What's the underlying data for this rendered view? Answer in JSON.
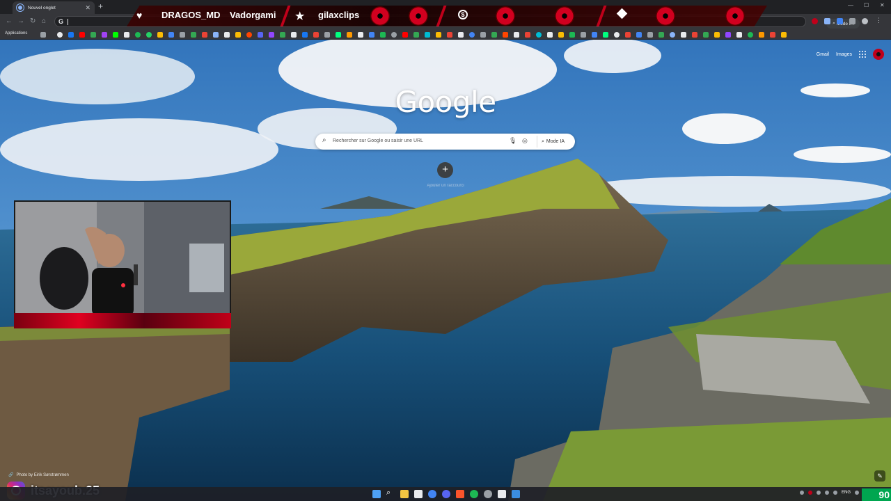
{
  "tab": {
    "title": "Nouvel onglet"
  },
  "toolbar": {
    "omnibox_prefix": "G",
    "mode_ia": "Mode IA"
  },
  "bookmarks": {
    "apps_label": "Applications"
  },
  "overlay": {
    "item1": "DRAGOS_MD",
    "item2": "Vadorgami",
    "item3": "gilaxclips"
  },
  "ntp": {
    "gmail": "Gmail",
    "images": "Images",
    "logo": "Google",
    "search_placeholder": "Rechercher sur Google ou saisir une URL",
    "mode_ia": "Mode IA",
    "shortcut_label": "Ajouter un raccourci",
    "photo_credit": "Photo by Eirik Sørstrømmen"
  },
  "stream": {
    "instagram_handle": "itsayoub.25",
    "fps_counter": "90"
  },
  "taskbar": {
    "lang": "ENG"
  },
  "colors": {
    "accent": "#c0001a",
    "browser_dark": "#202124",
    "toolbar": "#35363a",
    "badge_green": "#00a650"
  }
}
